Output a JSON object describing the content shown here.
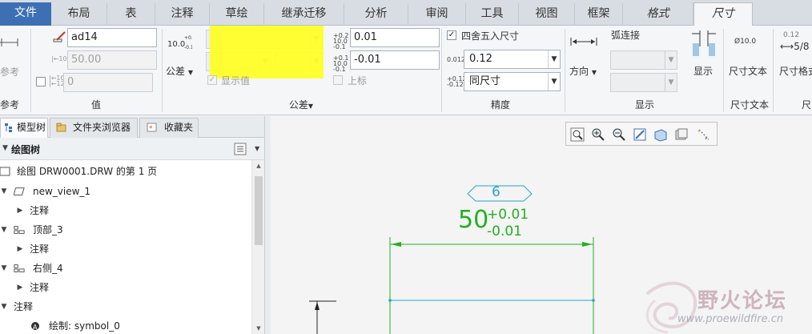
{
  "tabs": [
    "文件",
    "布局",
    "表",
    "注释",
    "草绘",
    "继承迁移",
    "分析",
    "审阅",
    "工具",
    "视图",
    "框架",
    "格式",
    "尺寸"
  ],
  "ribbon": {
    "reference": {
      "button_label": "参考",
      "group_label": "参考"
    },
    "value": {
      "name_value": "ad14",
      "nominal_value": "50.00",
      "override_value": "0",
      "group_label": "值"
    },
    "tolerance": {
      "tolerance_button_label": "公差",
      "show_value_label": "显示值",
      "upper_tol": "0.01",
      "lower_tol": "-0.01",
      "upper_label": "上标",
      "group_label": "公差"
    },
    "precision": {
      "round_label": "四舍五入尺寸",
      "decimals": "0.12",
      "tol_decimals": "同尺寸",
      "group_label": "精度"
    },
    "display": {
      "direction_label": "方向",
      "arc_label": "弧连接",
      "display_label": "显示",
      "group_label": "显示"
    },
    "dim_text": {
      "button_label": "尺寸文本",
      "icon_value": "Ø10.0",
      "group_label": "尺寸文本"
    },
    "dim_format": {
      "button_label": "尺寸格式",
      "group_label": "尺"
    }
  },
  "panel": {
    "tabs": [
      "模型树",
      "文件夹浏览器",
      "收藏夹"
    ],
    "tree_title": "绘图树",
    "items": [
      {
        "label": "绘图 DRW0001.DRW 的第 1 页"
      },
      {
        "label": "new_view_1"
      },
      {
        "label": "注释"
      },
      {
        "label": "顶部_3"
      },
      {
        "label": "注释"
      },
      {
        "label": "右侧_4"
      },
      {
        "label": "注释"
      },
      {
        "label": "注释"
      },
      {
        "label": "绘制: symbol_0"
      }
    ]
  },
  "drawing": {
    "symbol_text": "6",
    "dim_value": "50",
    "tol_upper": "+0.01",
    "tol_lower": "-0.01"
  },
  "watermark": {
    "logo_text": "野火论坛",
    "url": "www.proewildfire.cn"
  },
  "colors": {
    "accent": "#3d6fb5",
    "highlight": "#ffff22",
    "dimension_green": "#22b022",
    "symbol_cyan": "#25a6c8"
  }
}
